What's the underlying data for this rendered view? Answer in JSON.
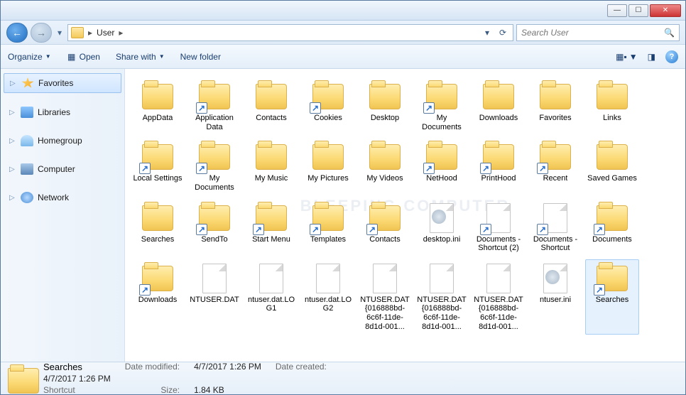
{
  "breadcrumb": {
    "root_icon": "folder",
    "crumb1": "User"
  },
  "search": {
    "placeholder": "Search User"
  },
  "toolbar": {
    "organize": "Organize",
    "open": "Open",
    "share": "Share with",
    "newfolder": "New folder"
  },
  "sidebar": {
    "items": [
      {
        "label": "Favorites",
        "icon": "fav",
        "active": true
      },
      {
        "label": "Libraries",
        "icon": "lib"
      },
      {
        "label": "Homegroup",
        "icon": "home"
      },
      {
        "label": "Computer",
        "icon": "comp"
      },
      {
        "label": "Network",
        "icon": "net"
      }
    ]
  },
  "files": [
    {
      "name": "AppData",
      "type": "folder"
    },
    {
      "name": "Application Data",
      "type": "folder",
      "shortcut": true
    },
    {
      "name": "Contacts",
      "type": "folder",
      "overlay": "contacts"
    },
    {
      "name": "Cookies",
      "type": "folder",
      "shortcut": true
    },
    {
      "name": "Desktop",
      "type": "folder",
      "overlay": "desktop"
    },
    {
      "name": "My Documents",
      "type": "folder",
      "shortcut": true,
      "overlay": "doc"
    },
    {
      "name": "Downloads",
      "type": "folder"
    },
    {
      "name": "Favorites",
      "type": "folder",
      "overlay": "star"
    },
    {
      "name": "Links",
      "type": "folder",
      "overlay": "link"
    },
    {
      "name": "Local Settings",
      "type": "folder",
      "shortcut": true
    },
    {
      "name": "My Documents",
      "type": "folder",
      "shortcut": true
    },
    {
      "name": "My Music",
      "type": "folder",
      "overlay": "music"
    },
    {
      "name": "My Pictures",
      "type": "folder",
      "overlay": "pic"
    },
    {
      "name": "My Videos",
      "type": "folder",
      "overlay": "vid"
    },
    {
      "name": "NetHood",
      "type": "folder",
      "shortcut": true
    },
    {
      "name": "PrintHood",
      "type": "folder",
      "shortcut": true,
      "overlay": "print"
    },
    {
      "name": "Recent",
      "type": "folder",
      "shortcut": true
    },
    {
      "name": "Saved Games",
      "type": "folder",
      "overlay": "chess"
    },
    {
      "name": "Searches",
      "type": "folder",
      "overlay": "search"
    },
    {
      "name": "SendTo",
      "type": "folder",
      "shortcut": true
    },
    {
      "name": "Start Menu",
      "type": "folder",
      "shortcut": true
    },
    {
      "name": "Templates",
      "type": "folder",
      "shortcut": true
    },
    {
      "name": "Contacts",
      "type": "folder",
      "shortcut": true
    },
    {
      "name": "desktop.ini",
      "type": "file",
      "gear": true
    },
    {
      "name": "Documents - Shortcut (2)",
      "type": "file",
      "shortcut": true,
      "overlay": "doc"
    },
    {
      "name": "Documents - Shortcut",
      "type": "file",
      "shortcut": true,
      "overlay": "doc"
    },
    {
      "name": "Documents",
      "type": "folder",
      "shortcut": true
    },
    {
      "name": "Downloads",
      "type": "folder",
      "shortcut": true
    },
    {
      "name": "NTUSER.DAT",
      "type": "file"
    },
    {
      "name": "ntuser.dat.LOG1",
      "type": "file"
    },
    {
      "name": "ntuser.dat.LOG2",
      "type": "file"
    },
    {
      "name": "NTUSER.DAT{016888bd-6c6f-11de-8d1d-001...",
      "type": "file"
    },
    {
      "name": "NTUSER.DAT{016888bd-6c6f-11de-8d1d-001...",
      "type": "file"
    },
    {
      "name": "NTUSER.DAT{016888bd-6c6f-11de-8d1d-001...",
      "type": "file"
    },
    {
      "name": "ntuser.ini",
      "type": "file",
      "gear": true
    },
    {
      "name": "Searches",
      "type": "folder",
      "shortcut": true,
      "selected": true
    }
  ],
  "status": {
    "name": "Searches",
    "type": "Shortcut",
    "modified_label": "Date modified:",
    "modified": "4/7/2017 1:26 PM",
    "created_label": "Date created:",
    "created": "4/7/2017 1:26 PM",
    "size_label": "Size:",
    "size": "1.84 KB"
  },
  "watermark": "BLEEPING\nCOMPUTER"
}
